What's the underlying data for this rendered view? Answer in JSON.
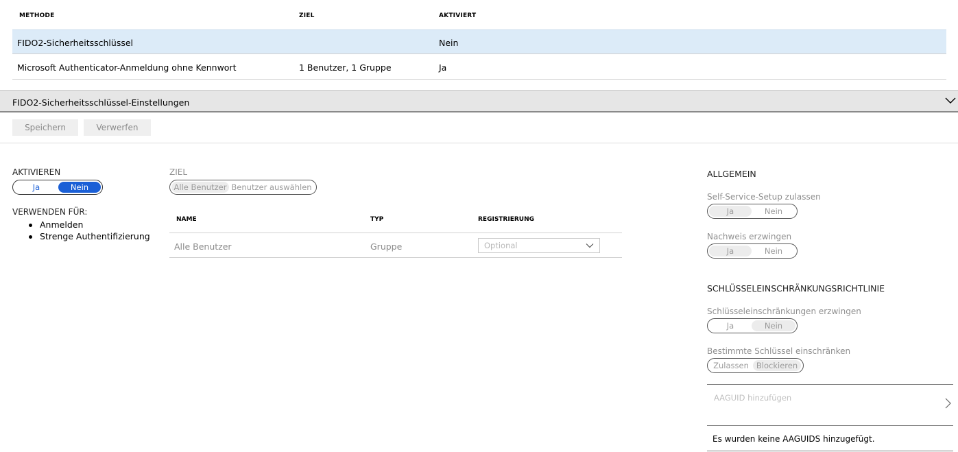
{
  "methods_table": {
    "columns": [
      "METHODE",
      "ZIEL",
      "AKTIVIERT"
    ],
    "rows": [
      {
        "method": "FIDO2-Sicherheitsschlüssel",
        "target": "",
        "enabled": "Nein"
      },
      {
        "method": "Microsoft Authenticator-Anmeldung ohne Kennwort",
        "target": "1 Benutzer, 1 Gruppe",
        "enabled": "Ja"
      }
    ]
  },
  "settings": {
    "title": "FIDO2-Sicherheitsschlüssel-Einstellungen",
    "save_label": "Speichern",
    "discard_label": "Verwerfen"
  },
  "activate": {
    "label": "AKTIVIEREN",
    "yes": "Ja",
    "no": "Nein",
    "selected": "Nein"
  },
  "use_for": {
    "label": "VERWENDEN FÜR:",
    "items": [
      "Anmelden",
      "Strenge Authentifizierung"
    ]
  },
  "target": {
    "label": "ZIEL",
    "all_users": "Alle Benutzer",
    "select_users": "Benutzer auswählen",
    "table": {
      "columns": [
        "NAME",
        "TYP",
        "REGISTRIERUNG"
      ],
      "rows": [
        {
          "name": "Alle Benutzer",
          "type": "Gruppe",
          "registration": "Optional"
        }
      ]
    }
  },
  "general": {
    "heading": "ALLGEMEIN",
    "self_service": {
      "label": "Self-Service-Setup zulassen",
      "yes": "Ja",
      "no": "Nein",
      "selected": "Ja"
    },
    "attestation": {
      "label": "Nachweis erzwingen",
      "yes": "Ja",
      "no": "Nein",
      "selected": "Ja"
    }
  },
  "key_policy": {
    "heading": "SCHLÜSSELEINSCHRÄNKUNGSRICHTLINIE",
    "enforce": {
      "label": "Schlüsseleinschränkungen erzwingen",
      "yes": "Ja",
      "no": "Nein",
      "selected": "Nein"
    },
    "restrict": {
      "label": "Bestimmte Schlüssel einschränken",
      "allow": "Zulassen",
      "block": "Blockieren",
      "selected": "Blockieren"
    },
    "aaguid_placeholder": "AAGUID hinzufügen",
    "empty_message": "Es wurden keine AAGUIDS hinzugefügt."
  },
  "colors": {
    "selected_row": "#dcebf8",
    "accent_blue": "#1a5fd6",
    "section_bar": "#e6e6e6"
  }
}
